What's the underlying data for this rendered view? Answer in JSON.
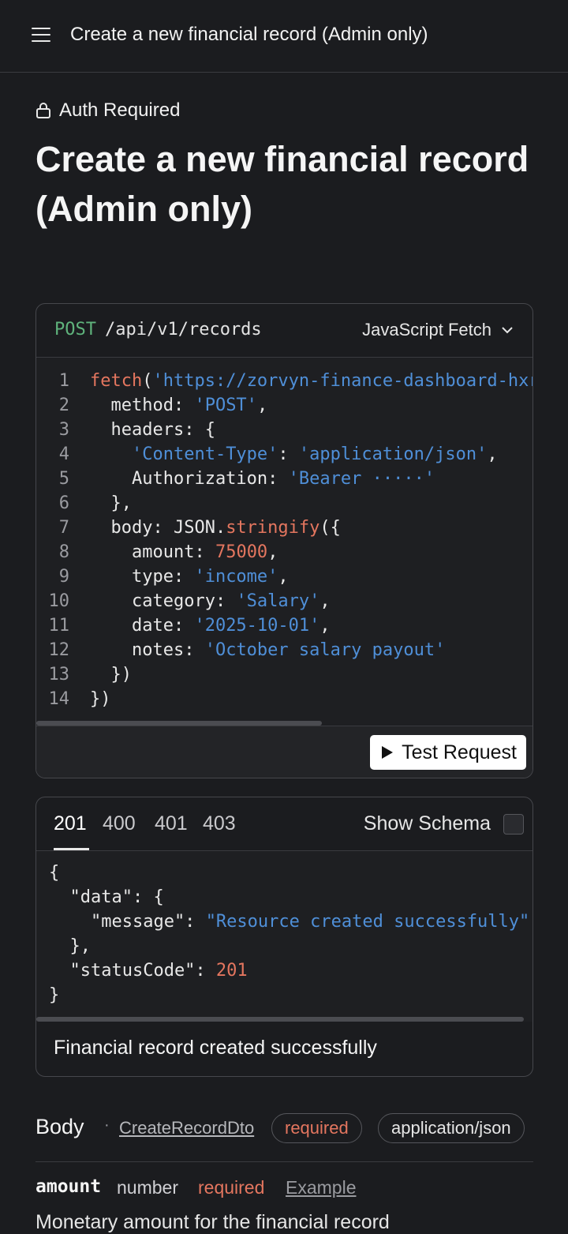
{
  "header": {
    "title": "Create a new financial record (Admin only)"
  },
  "auth_label": "Auth Required",
  "page_title": "Create a new financial record (Admin only)",
  "request": {
    "method": "POST",
    "path": "/api/v1/records",
    "language": "JavaScript Fetch",
    "test_button": "Test Request",
    "code_lines": [
      {
        "n": "1",
        "parts": [
          [
            "fn",
            "fetch"
          ],
          [
            "txt",
            "("
          ],
          [
            "str",
            "'https://zorvyn-finance-dashboard-hxr"
          ]
        ]
      },
      {
        "n": "2",
        "parts": [
          [
            "txt",
            "  method: "
          ],
          [
            "str",
            "'POST'"
          ],
          [
            "txt",
            ","
          ]
        ]
      },
      {
        "n": "3",
        "parts": [
          [
            "txt",
            "  headers: {"
          ]
        ]
      },
      {
        "n": "4",
        "parts": [
          [
            "txt",
            "    "
          ],
          [
            "str",
            "'Content-Type'"
          ],
          [
            "txt",
            ": "
          ],
          [
            "str",
            "'application/json'"
          ],
          [
            "txt",
            ","
          ]
        ]
      },
      {
        "n": "5",
        "parts": [
          [
            "txt",
            "    Authorization: "
          ],
          [
            "str",
            "'Bearer ·····'"
          ]
        ]
      },
      {
        "n": "6",
        "parts": [
          [
            "txt",
            "  },"
          ]
        ]
      },
      {
        "n": "7",
        "parts": [
          [
            "txt",
            "  body: JSON."
          ],
          [
            "fn",
            "stringify"
          ],
          [
            "txt",
            "({"
          ]
        ]
      },
      {
        "n": "8",
        "parts": [
          [
            "txt",
            "    amount: "
          ],
          [
            "num",
            "75000"
          ],
          [
            "txt",
            ","
          ]
        ]
      },
      {
        "n": "9",
        "parts": [
          [
            "txt",
            "    type: "
          ],
          [
            "str",
            "'income'"
          ],
          [
            "txt",
            ","
          ]
        ]
      },
      {
        "n": "10",
        "parts": [
          [
            "txt",
            "    category: "
          ],
          [
            "str",
            "'Salary'"
          ],
          [
            "txt",
            ","
          ]
        ]
      },
      {
        "n": "11",
        "parts": [
          [
            "txt",
            "    date: "
          ],
          [
            "str",
            "'2025-10-01'"
          ],
          [
            "txt",
            ","
          ]
        ]
      },
      {
        "n": "12",
        "parts": [
          [
            "txt",
            "    notes: "
          ],
          [
            "str",
            "'October salary payout'"
          ]
        ]
      },
      {
        "n": "13",
        "parts": [
          [
            "txt",
            "  })"
          ]
        ]
      },
      {
        "n": "14",
        "parts": [
          [
            "txt",
            "})"
          ]
        ]
      }
    ]
  },
  "response": {
    "tabs": [
      "201",
      "400",
      "401",
      "403"
    ],
    "active_tab": "201",
    "show_schema_label": "Show Schema",
    "json_lines": [
      {
        "parts": [
          [
            "txt",
            "{"
          ]
        ]
      },
      {
        "parts": [
          [
            "txt",
            "  \"data\": {"
          ]
        ]
      },
      {
        "parts": [
          [
            "txt",
            "    \"message\": "
          ],
          [
            "str",
            "\"Resource created successfully\""
          ]
        ]
      },
      {
        "parts": [
          [
            "txt",
            "  },"
          ]
        ]
      },
      {
        "parts": [
          [
            "txt",
            "  \"statusCode\": "
          ],
          [
            "num",
            "201"
          ]
        ]
      },
      {
        "parts": [
          [
            "txt",
            "}"
          ]
        ]
      }
    ],
    "description": "Financial record created successfully"
  },
  "body_section": {
    "label": "Body",
    "separator": "·",
    "dto": "CreateRecordDto",
    "required_pill": "required",
    "content_type_pill": "application/json",
    "property": {
      "name": "amount",
      "type": "number",
      "required": "required",
      "example": "Example",
      "description": "Monetary amount for the financial record"
    }
  },
  "colors": {
    "background": "#1b1c1f",
    "method_post": "#5fb37c",
    "string": "#4f8fd8",
    "keyword": "#e4765f"
  }
}
